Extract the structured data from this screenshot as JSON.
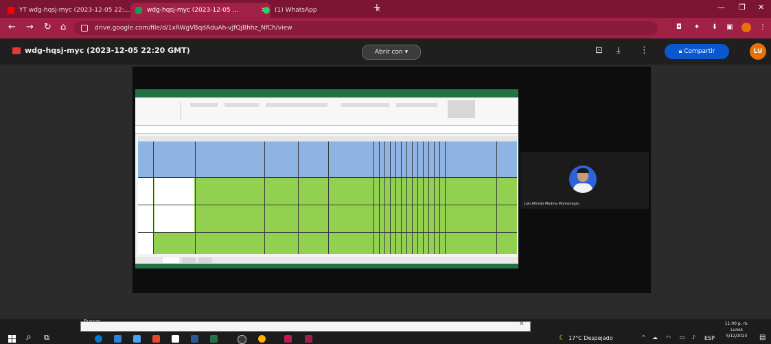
{
  "browser": {
    "tabs": [
      {
        "label": "YT wdg-hqsj-myc (2023-12-05 22:...",
        "color": "#ff0000"
      },
      {
        "label": "wdg-hqsj-myc (2023-12-05 ...",
        "color": "#0f9d58"
      },
      {
        "label": "(1) WhatsApp",
        "color": "#25d366"
      }
    ],
    "new_tab": "+",
    "url": "drive.google.com/file/d/1xRWgVBqdAduAh-vJfQjBhhz_NfCh/view"
  },
  "viewer": {
    "file_title": "wdg-hqsj-myc (2023-12-05 22:20 GMT)",
    "open_with": "Abrir con",
    "share": "Compartir",
    "avatar_initials": "LU"
  },
  "participant": {
    "name": "Luis Alfredo Medina Montenegro"
  },
  "taskbar": {
    "search_label": "Buscar",
    "weather": "17°C Despejado",
    "lang": "ESP",
    "time": "11:00 p. m.",
    "date_line": "Lunes",
    "date": "5/12/2023"
  },
  "icons": {
    "back": "back-arrow-icon",
    "forward": "forward-arrow-icon",
    "reload": "reload-icon",
    "home": "home-icon",
    "download": "download-icon",
    "more": "kebab-menu-icon",
    "windows": "windows-start-icon"
  }
}
